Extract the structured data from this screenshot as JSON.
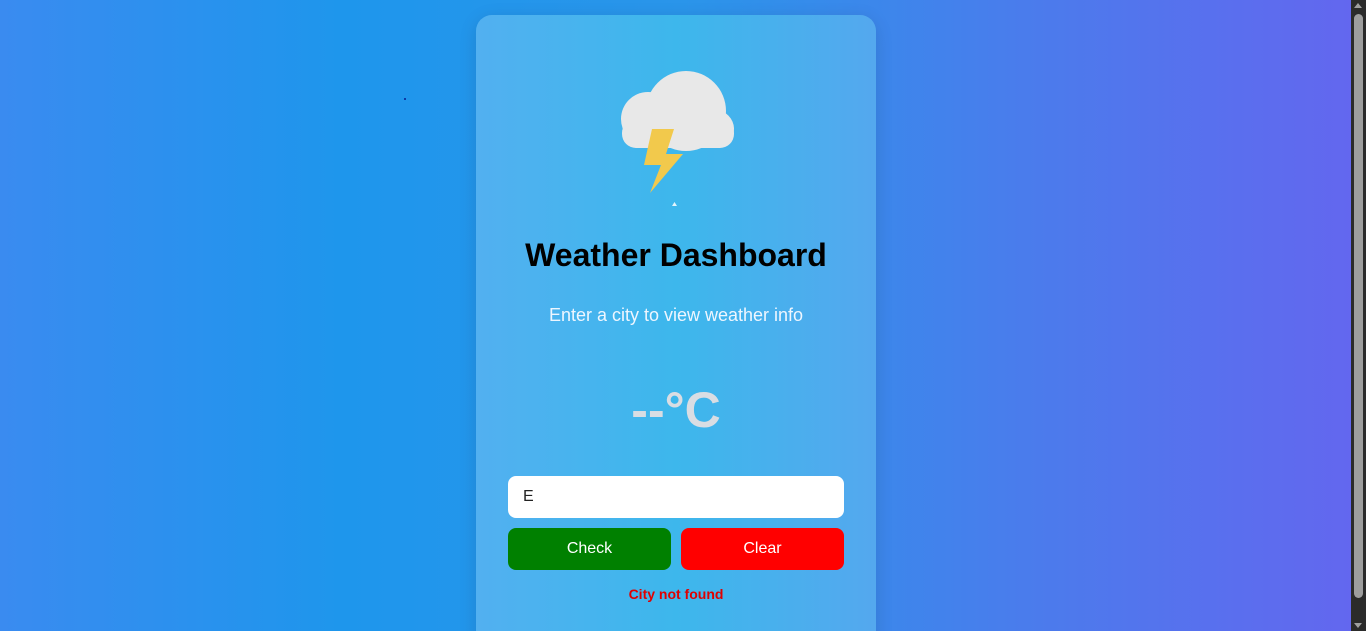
{
  "app": {
    "title": "Weather Dashboard",
    "subtitle": "Enter a city to view weather info"
  },
  "weather": {
    "icon": "thunderstorm-icon",
    "temperature": "--°C"
  },
  "search": {
    "value": "E",
    "placeholder": ""
  },
  "buttons": {
    "check_label": "Check",
    "clear_label": "Clear"
  },
  "status": {
    "error": "City not found"
  },
  "colors": {
    "check_button": "#008000",
    "clear_button": "#ff0000",
    "error_text": "#e00000",
    "cloud": "#e8e8e8",
    "lightning": "#f2c94c"
  }
}
